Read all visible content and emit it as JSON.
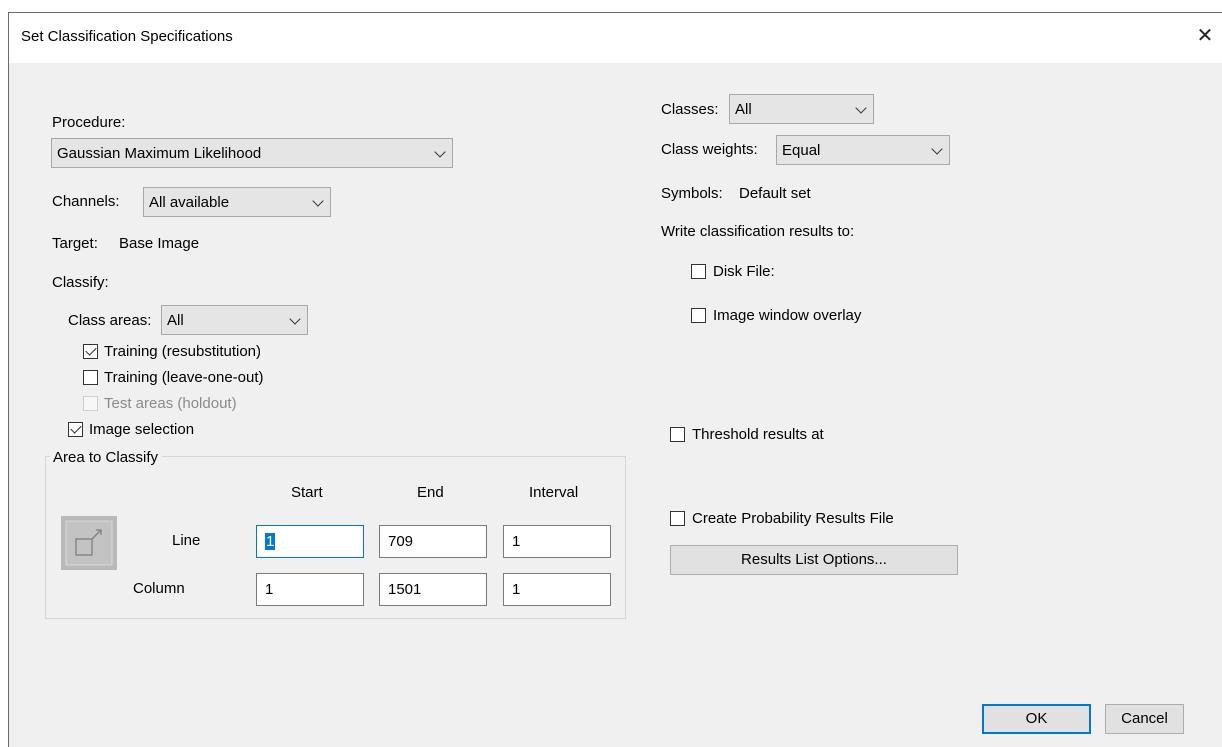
{
  "window": {
    "title": "Set Classification Specifications",
    "close_glyph": "✕"
  },
  "left": {
    "procedure_label": "Procedure:",
    "procedure_value": "Gaussian Maximum Likelihood",
    "channels_label": "Channels:",
    "channels_value": "All available",
    "target_label": "Target:",
    "target_value": "Base Image",
    "classify_label": "Classify:",
    "class_areas_label": "Class areas:",
    "class_areas_value": "All",
    "training_resub": {
      "label": "Training (resubstitution)",
      "checked": true
    },
    "training_loo": {
      "label": "Training (leave-one-out)",
      "checked": false
    },
    "test_areas": {
      "label": "Test areas (holdout)",
      "checked": false,
      "disabled": true
    },
    "image_selection": {
      "label": "Image selection",
      "checked": true
    }
  },
  "area": {
    "group_label": "Area to Classify",
    "col_start": "Start",
    "col_end": "End",
    "col_interval": "Interval",
    "line_label": "Line",
    "column_label": "Column",
    "line_start": "1",
    "line_end": "709",
    "line_interval": "1",
    "column_start": "1",
    "column_end": "1501",
    "column_interval": "1",
    "icon": "area-select-icon"
  },
  "right": {
    "classes_label": "Classes:",
    "classes_value": "All",
    "weights_label": "Class weights:",
    "weights_value": "Equal",
    "symbols_label": "Symbols:",
    "symbols_value": "Default set",
    "write_label": "Write classification results to:",
    "disk_file": {
      "label": "Disk File:",
      "checked": false
    },
    "overlay": {
      "label": "Image window overlay",
      "checked": false
    },
    "threshold": {
      "label": "Threshold results at",
      "checked": false
    },
    "probability": {
      "label": "Create Probability Results File",
      "checked": false
    },
    "results_list_button": "Results List Options..."
  },
  "footer": {
    "ok": "OK",
    "cancel": "Cancel"
  },
  "colors": {
    "accent": "#0078d7",
    "client_bg": "#f0f0f0"
  }
}
